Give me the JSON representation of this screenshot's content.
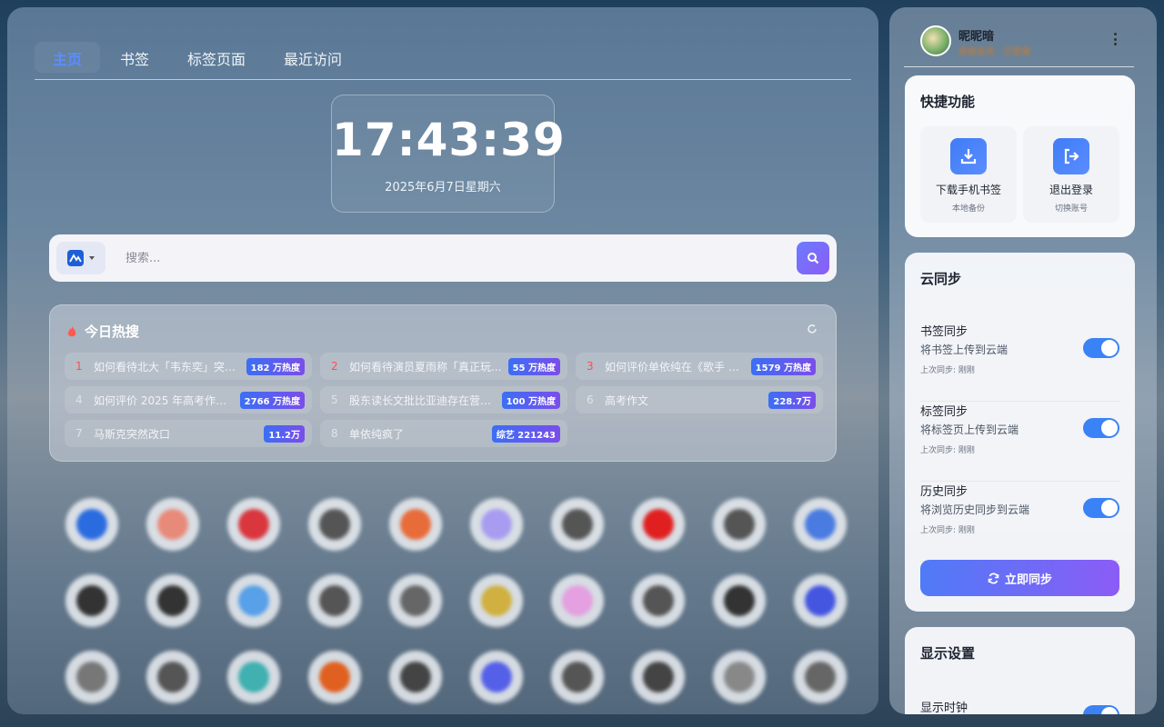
{
  "tabs": [
    {
      "label": "主页",
      "active": true
    },
    {
      "label": "书签",
      "active": false
    },
    {
      "label": "标签页面",
      "active": false
    },
    {
      "label": "最近访问",
      "active": false
    }
  ],
  "clock": {
    "time": "17:43:39",
    "date": "2025年6月7日星期六"
  },
  "search": {
    "placeholder": "搜索...",
    "engine_icon": "engine-logo-icon"
  },
  "hot": {
    "title": "今日热搜",
    "items": [
      {
        "rank": "1",
        "text": "如何看待北大「韦东奕」突然...",
        "badge": "182 万热度"
      },
      {
        "rank": "2",
        "text": "如何看待演员夏雨称「真正玩...",
        "badge": "55 万热度"
      },
      {
        "rank": "3",
        "text": "如何评价单依纯在《歌手 20...",
        "badge": "1579 万热度"
      },
      {
        "rank": "4",
        "text": "如何评价 2025 年高考作文题...",
        "badge": "2766 万热度"
      },
      {
        "rank": "5",
        "text": "股东读长文批比亚迪存在营销...",
        "badge": "100 万热度"
      },
      {
        "rank": "6",
        "text": "高考作文",
        "badge": "228.7万"
      },
      {
        "rank": "7",
        "text": "马斯克突然改口",
        "badge": "11.2万"
      },
      {
        "rank": "8",
        "text": "单依纯疯了",
        "badge": "综艺 221243"
      }
    ]
  },
  "shortcuts": [
    {
      "label": "",
      "color": "#2b6be0"
    },
    {
      "label": "",
      "color": "#e88a7a"
    },
    {
      "label": "",
      "color": "#d9363e"
    },
    {
      "label": "",
      "color": "#555555"
    },
    {
      "label": "",
      "color": "#e86b3a"
    },
    {
      "label": "",
      "color": "#a79cf0"
    },
    {
      "label": "",
      "color": "#555555"
    },
    {
      "label": "",
      "color": "#e02020"
    },
    {
      "label": "",
      "color": "#555555"
    },
    {
      "label": "",
      "color": "#4a7be0"
    },
    {
      "label": "",
      "color": "#333333"
    },
    {
      "label": "",
      "color": "#333333"
    },
    {
      "label": "",
      "color": "#58a0e8"
    },
    {
      "label": "",
      "color": "#555555"
    },
    {
      "label": "",
      "color": "#666666"
    },
    {
      "label": "",
      "color": "#d0b040"
    },
    {
      "label": "",
      "color": "#e4a0e0"
    },
    {
      "label": "",
      "color": "#555555"
    },
    {
      "label": "",
      "color": "#333333"
    },
    {
      "label": "",
      "color": "#4456e0"
    },
    {
      "label": "",
      "color": "#777777"
    },
    {
      "label": "",
      "color": "#555555"
    },
    {
      "label": "",
      "color": "#40b0b0"
    },
    {
      "label": "",
      "color": "#e06020"
    },
    {
      "label": "",
      "color": "#444444"
    },
    {
      "label": "",
      "color": "#5560e8"
    },
    {
      "label": "",
      "color": "#555555"
    },
    {
      "label": "",
      "color": "#444444"
    },
    {
      "label": "",
      "color": "#888888"
    },
    {
      "label": "",
      "color": "#666666"
    }
  ],
  "user": {
    "name": "昵昵暗",
    "sub": "高级会员 · 已登录"
  },
  "quick": {
    "title": "快捷功能",
    "download_label": "下载手机书签",
    "download_sub": "本地备份",
    "logout_label": "退出登录",
    "logout_sub": "切换账号"
  },
  "sync": {
    "title": "云同步",
    "items": [
      {
        "name": "书签同步",
        "desc": "将书签上传到云端",
        "last": "上次同步: 刚刚",
        "on": true
      },
      {
        "name": "标签同步",
        "desc": "将标签页上传到云端",
        "last": "上次同步: 刚刚",
        "on": true
      },
      {
        "name": "历史同步",
        "desc": "将浏览历史同步到云端",
        "last": "上次同步: 刚刚",
        "on": true
      }
    ],
    "button_label": "立即同步"
  },
  "display": {
    "title": "显示设置",
    "clock_label": "显示时钟"
  },
  "colors": {
    "accent": "#3b82f6",
    "rank_top": "#ff4d4f",
    "badge_start": "#3b6ff5",
    "badge_end": "#7b4dea"
  }
}
